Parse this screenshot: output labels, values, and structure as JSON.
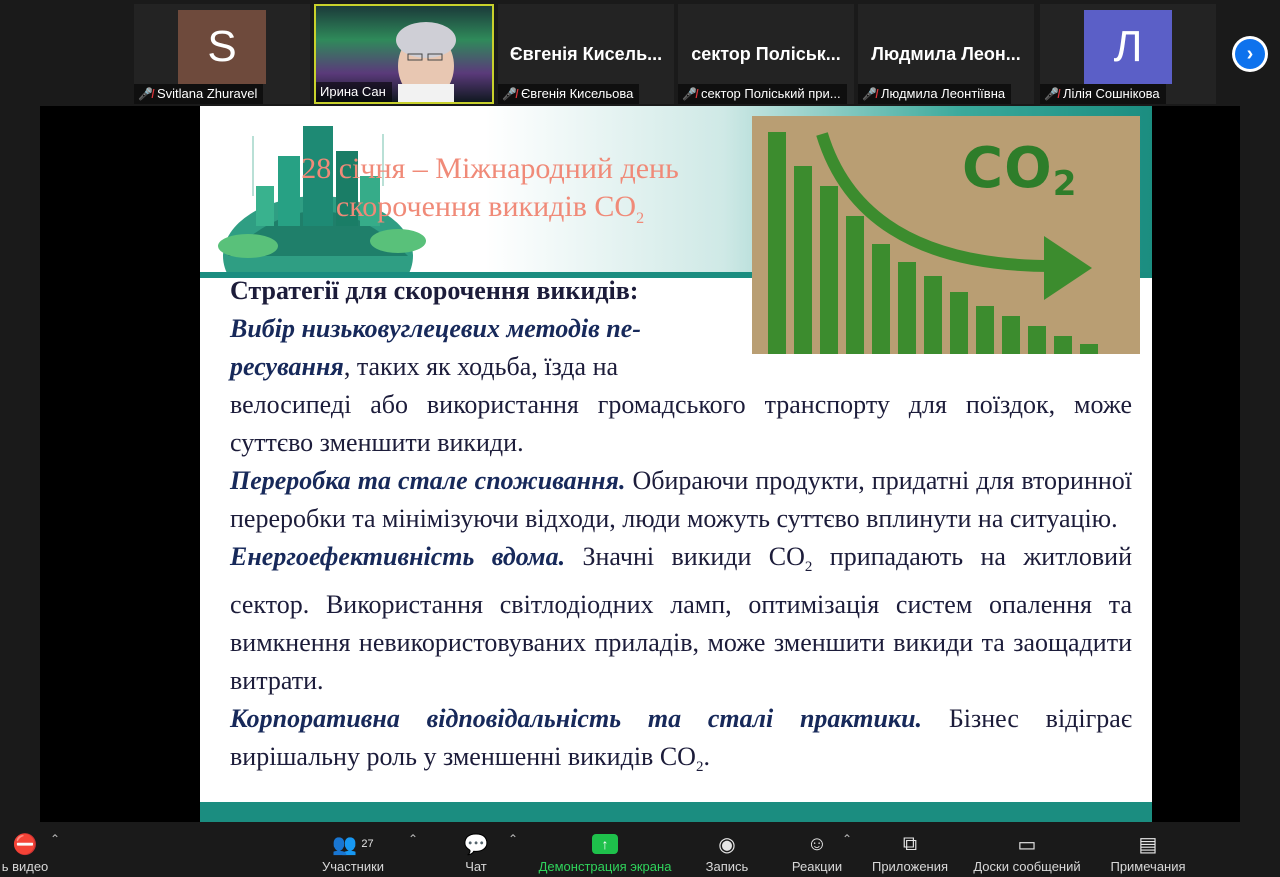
{
  "participants": [
    {
      "label": "Svitlana Zhuravel",
      "avatar_letter": "S",
      "avatar_color": "#6e4a3c",
      "muted": true
    },
    {
      "label": "Ирина Сан",
      "muted": false
    },
    {
      "bigname": "Євгенія  Кисель...",
      "label": "Євгенія Кисельова",
      "muted": true
    },
    {
      "bigname": "сектор  Поліськ...",
      "label": "сектор Поліський при...",
      "muted": true
    },
    {
      "bigname": "Людмила  Леон...",
      "label": "Людмила Леонтіївна",
      "muted": true
    },
    {
      "label": "Лілія Сошнікова",
      "avatar_letter": "Л",
      "avatar_color": "#5b5fc7",
      "muted": true
    }
  ],
  "slide": {
    "title_line1": "28 січня – Міжнародний день",
    "title_line2": "скорочення викидів  CO",
    "title_sub": "2",
    "image_text": "CO",
    "image_sub": "2",
    "heading": "Стратегії для скорочення викидів:",
    "p1_bold": "Вибір низьковуглецевих методів пе-ресування",
    "p1_rest": ", таких як ходьба, їзда на",
    "p1_cont": "велосипеді або використання громадського транспорту для поїздок, може суттєво зменшити викиди.",
    "p2_bold": "Переробка та стале споживання.",
    "p2_rest": " Обираючи продукти, придатні для вторинної переробки та мінімізуючи відходи, люди можуть суттєво вплинути на ситуацію.",
    "p3_bold": "Енергоефективність вдома.",
    "p3_rest_a": " Значні викиди СО",
    "p3_sub": "2",
    "p3_rest_b": " припадають на житловий сектор. Використання світлодіодних ламп, оптимізація систем опалення та вимкнення невикористовуваних приладів, може зменшити викиди та заощадити витрати.",
    "p4_bold": "Корпоративна відповідальність та сталі практики.",
    "p4_rest_a": " Бізнес відіграє вирішальну роль у зменшенні викидів СО",
    "p4_sub": "2",
    "p4_rest_b": "."
  },
  "toolbar": {
    "video_label": "ь видео",
    "participants_label": "Участники",
    "participants_count": "27",
    "chat_label": "Чат",
    "share_label": "Демонстрация экрана",
    "record_label": "Запись",
    "reactions_label": "Реакции",
    "apps_label": "Приложения",
    "boards_label": "Доски сообщений",
    "notes_label": "Примечания"
  }
}
